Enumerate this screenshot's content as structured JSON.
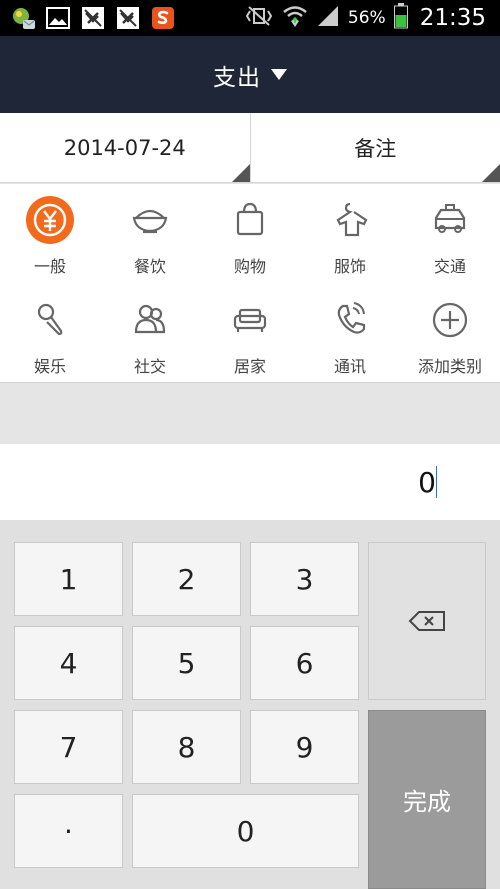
{
  "status_bar": {
    "notification_icons": [
      "cloud-weather-icon",
      "gallery-icon",
      "muted-app-icon",
      "muted-app-icon",
      "sogou-icon"
    ],
    "battery": "56%",
    "time": "21:35"
  },
  "header": {
    "title": "支出"
  },
  "info_row": {
    "date": "2014-07-24",
    "note": "备注"
  },
  "categories": [
    {
      "label": "一般",
      "icon": "yen-icon",
      "selected": true
    },
    {
      "label": "餐饮",
      "icon": "rice-bowl-icon"
    },
    {
      "label": "购物",
      "icon": "shopping-bag-icon"
    },
    {
      "label": "服饰",
      "icon": "shirt-icon"
    },
    {
      "label": "交通",
      "icon": "taxi-icon"
    },
    {
      "label": "娱乐",
      "icon": "microphone-icon"
    },
    {
      "label": "社交",
      "icon": "people-icon"
    },
    {
      "label": "居家",
      "icon": "sofa-icon"
    },
    {
      "label": "通讯",
      "icon": "phone-icon"
    },
    {
      "label": "添加类别",
      "icon": "add-circle-icon"
    }
  ],
  "amount": {
    "value": "0"
  },
  "keypad": {
    "keys": [
      "1",
      "2",
      "3",
      "4",
      "5",
      "6",
      "7",
      "8",
      "9",
      "·",
      "0"
    ],
    "done": "完成"
  },
  "colors": {
    "accent": "#f26b1d",
    "header_bg": "#1e2637",
    "caret": "#1a7fd4"
  }
}
